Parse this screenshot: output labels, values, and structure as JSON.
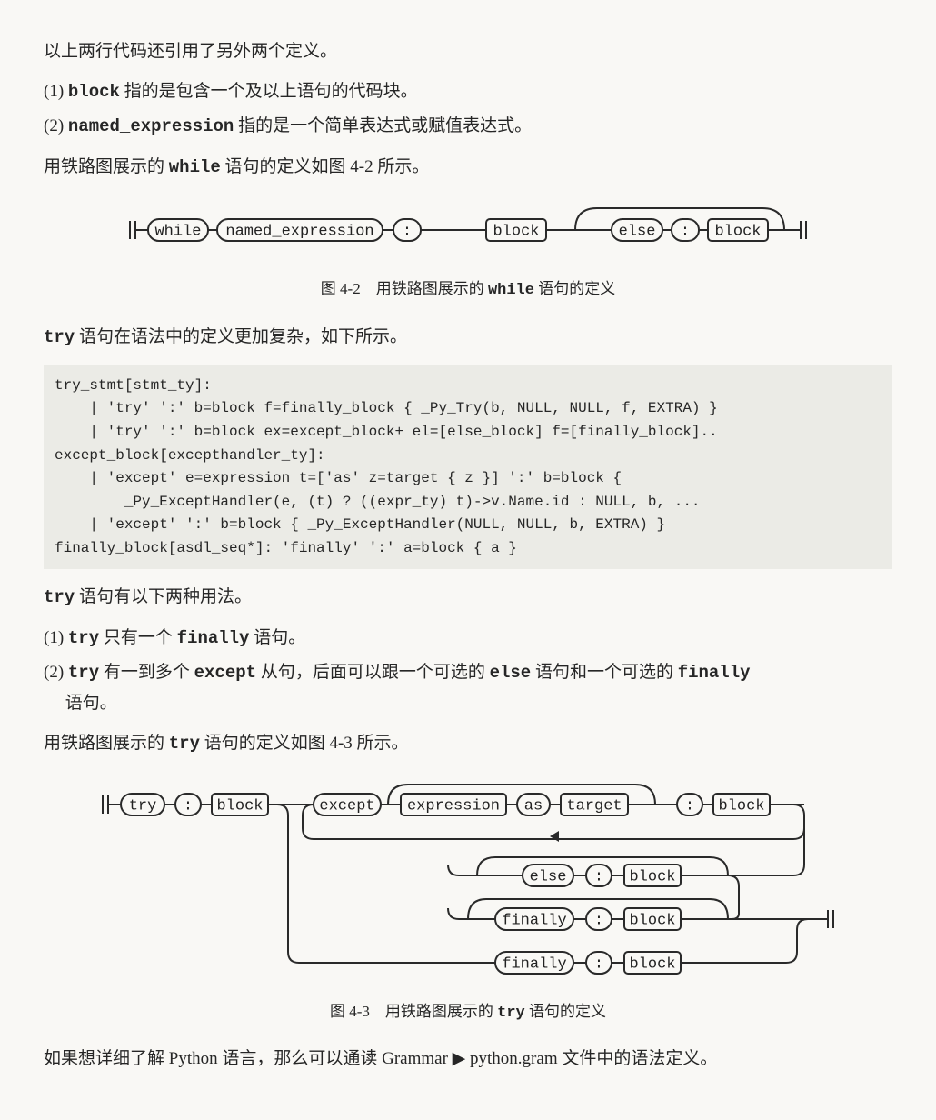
{
  "p_intro": "以上两行代码还引用了另外两个定义。",
  "defs": {
    "d1_prefix": "(1) ",
    "d1_code": "block",
    "d1_suffix": " 指的是包含一个及以上语句的代码块。",
    "d2_prefix": "(2) ",
    "d2_code": "named_expression",
    "d2_suffix": " 指的是一个简单表达式或赋值表达式。"
  },
  "p_while_lead_a": "用铁路图展示的 ",
  "p_while_lead_code": "while",
  "p_while_lead_b": " 语句的定义如图 4-2 所示。",
  "diagram_while": {
    "tokens": {
      "while": "while",
      "named_expression": "named_expression",
      "colon": ":",
      "block": "block",
      "else": "else"
    }
  },
  "fig42_a": "图 4-2　用铁路图展示的 ",
  "fig42_code": "while",
  "fig42_b": " 语句的定义",
  "p_try_lead_code": "try",
  "p_try_lead": " 语句在语法中的定义更加复杂，如下所示。",
  "codeblock": "try_stmt[stmt_ty]:\n    | 'try' ':' b=block f=finally_block { _Py_Try(b, NULL, NULL, f, EXTRA) }\n    | 'try' ':' b=block ex=except_block+ el=[else_block] f=[finally_block]..\nexcept_block[excepthandler_ty]:\n    | 'except' e=expression t=['as' z=target { z }] ':' b=block {\n        _Py_ExceptHandler(e, (t) ? ((expr_ty) t)->v.Name.id : NULL, b, ...\n    | 'except' ':' b=block { _Py_ExceptHandler(NULL, NULL, b, EXTRA) }\nfinally_block[asdl_seq*]: 'finally' ':' a=block { a }",
  "p_try_usage_code": "try",
  "p_try_usage": " 语句有以下两种用法。",
  "usage": {
    "u1_a": "(1) ",
    "u1_c1": "try",
    "u1_b": " 只有一个 ",
    "u1_c2": "finally",
    "u1_c": " 语句。",
    "u2_a": "(2) ",
    "u2_c1": "try",
    "u2_b": " 有一到多个 ",
    "u2_c2": "except",
    "u2_c": " 从句，后面可以跟一个可选的 ",
    "u2_c3": "else",
    "u2_d": " 语句和一个可选的 ",
    "u2_c4": "finally",
    "u2_e": " 语句。"
  },
  "p_try_diagram_lead_a": "用铁路图展示的 ",
  "p_try_diagram_lead_code": "try",
  "p_try_diagram_lead_b": " 语句的定义如图 4-3 所示。",
  "diagram_try": {
    "tokens": {
      "try": "try",
      "colon": ":",
      "block": "block",
      "except": "except",
      "expression": "expression",
      "as": "as",
      "target": "target",
      "else": "else",
      "finally": "finally"
    }
  },
  "fig43_a": "图 4-3　用铁路图展示的 ",
  "fig43_code": "try",
  "fig43_b": " 语句的定义",
  "outro_a": "如果想详细了解 Python 语言，那么可以通读 Grammar ",
  "outro_tri": "▶",
  "outro_b": " python.gram 文件中的语法定义。"
}
